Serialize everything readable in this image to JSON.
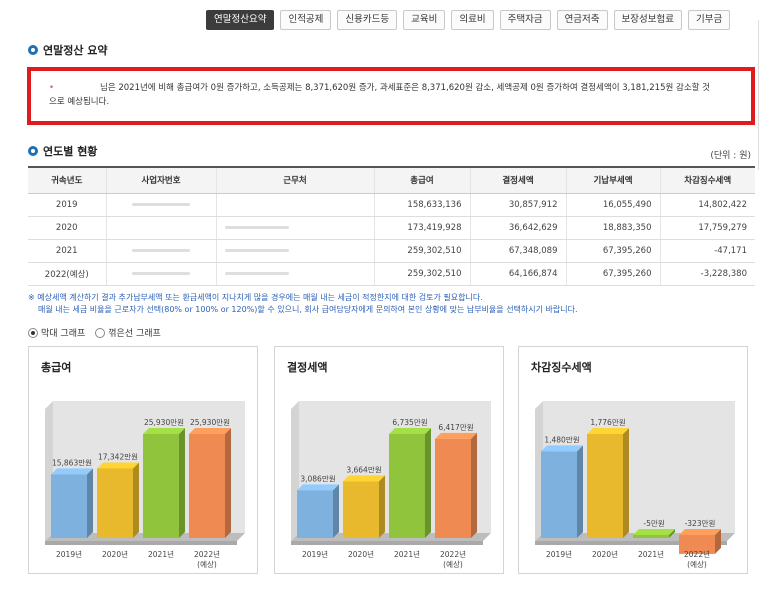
{
  "tabs": [
    {
      "label": "연말정산요약",
      "active": true
    },
    {
      "label": "인적공제",
      "active": false
    },
    {
      "label": "신용카드등",
      "active": false
    },
    {
      "label": "교육비",
      "active": false
    },
    {
      "label": "의료비",
      "active": false
    },
    {
      "label": "주택자금",
      "active": false
    },
    {
      "label": "연금저축",
      "active": false
    },
    {
      "label": "보장성보험료",
      "active": false
    },
    {
      "label": "기부금",
      "active": false
    }
  ],
  "summary": {
    "title": "연말정산 요약",
    "text_line1": "님은 2021년에 비해 총급여가 0원 증가하고, 소득공제는 8,371,620원 증가, 과세표준은 8,371,620원 감소, 세액공제 0원 증가하여 결정세액이 3,181,215원 감소할 것",
    "text_line2": "으로 예상됩니다."
  },
  "yearly": {
    "title": "연도별 현황",
    "unit": "(단위 : 원)",
    "headers": [
      "귀속년도",
      "사업자번호",
      "근무처",
      "총급여",
      "결정세액",
      "기납부세액",
      "차감징수세액"
    ],
    "rows": [
      [
        "2019",
        "",
        "",
        "158,633,136",
        "30,857,912",
        "16,055,490",
        "14,802,422"
      ],
      [
        "2020",
        "",
        "",
        "173,419,928",
        "36,642,629",
        "18,883,350",
        "17,759,279"
      ],
      [
        "2021",
        "",
        "",
        "259,302,510",
        "67,348,089",
        "67,395,260",
        "-47,171"
      ],
      [
        "2022(예상)",
        "",
        "",
        "259,302,510",
        "64,166,874",
        "67,395,260",
        "-3,228,380"
      ]
    ]
  },
  "note": {
    "line1": "※ 예상세액 계산하기 결과 추가납부세액 또는 환급세액이 지나치게 많을 경우에는 매월 내는 세금이 적정한지에 대한 검토가 필요합니다.",
    "line2": "매월 내는 세금 비율을 근로자가 선택(80% or 100% or 120%)할 수 있으니, 회사 급여담당자에게 문의하여 본인 상황에 맞는 납부비율을 선택하시기 바랍니다."
  },
  "graph_type": {
    "bar_label": "막대 그래프",
    "line_label": "꺾은선 그래프",
    "selected": "bar"
  },
  "chart_data": [
    {
      "type": "bar",
      "title": "총급여",
      "categories": [
        "2019년",
        "2020년",
        "2021년",
        "2022년"
      ],
      "category_sub": [
        "",
        "",
        "",
        "(예상)"
      ],
      "values": [
        15863,
        17342,
        25930,
        25930
      ],
      "value_labels": [
        "15,863만원",
        "17,342만원",
        "25,930만원",
        "25,930만원"
      ],
      "colors": [
        "#7fb1df",
        "#e8b92c",
        "#8fc43c",
        "#ef8a52"
      ]
    },
    {
      "type": "bar",
      "title": "결정세액",
      "categories": [
        "2019년",
        "2020년",
        "2021년",
        "2022년"
      ],
      "category_sub": [
        "",
        "",
        "",
        "(예상)"
      ],
      "values": [
        3086,
        3664,
        6735,
        6417
      ],
      "value_labels": [
        "3,086만원",
        "3,664만원",
        "6,735만원",
        "6,417만원"
      ],
      "colors": [
        "#7fb1df",
        "#e8b92c",
        "#8fc43c",
        "#ef8a52"
      ]
    },
    {
      "type": "bar",
      "title": "차감징수세액",
      "categories": [
        "2019년",
        "2020년",
        "2021년",
        "2022년"
      ],
      "category_sub": [
        "",
        "",
        "",
        "(예상)"
      ],
      "values": [
        1480,
        1776,
        -5,
        -323
      ],
      "value_labels": [
        "1,480만원",
        "1,776만원",
        "-5만원",
        "-323만원"
      ],
      "colors": [
        "#7fb1df",
        "#e8b92c",
        "#8fc43c",
        "#ef8a52"
      ]
    }
  ]
}
